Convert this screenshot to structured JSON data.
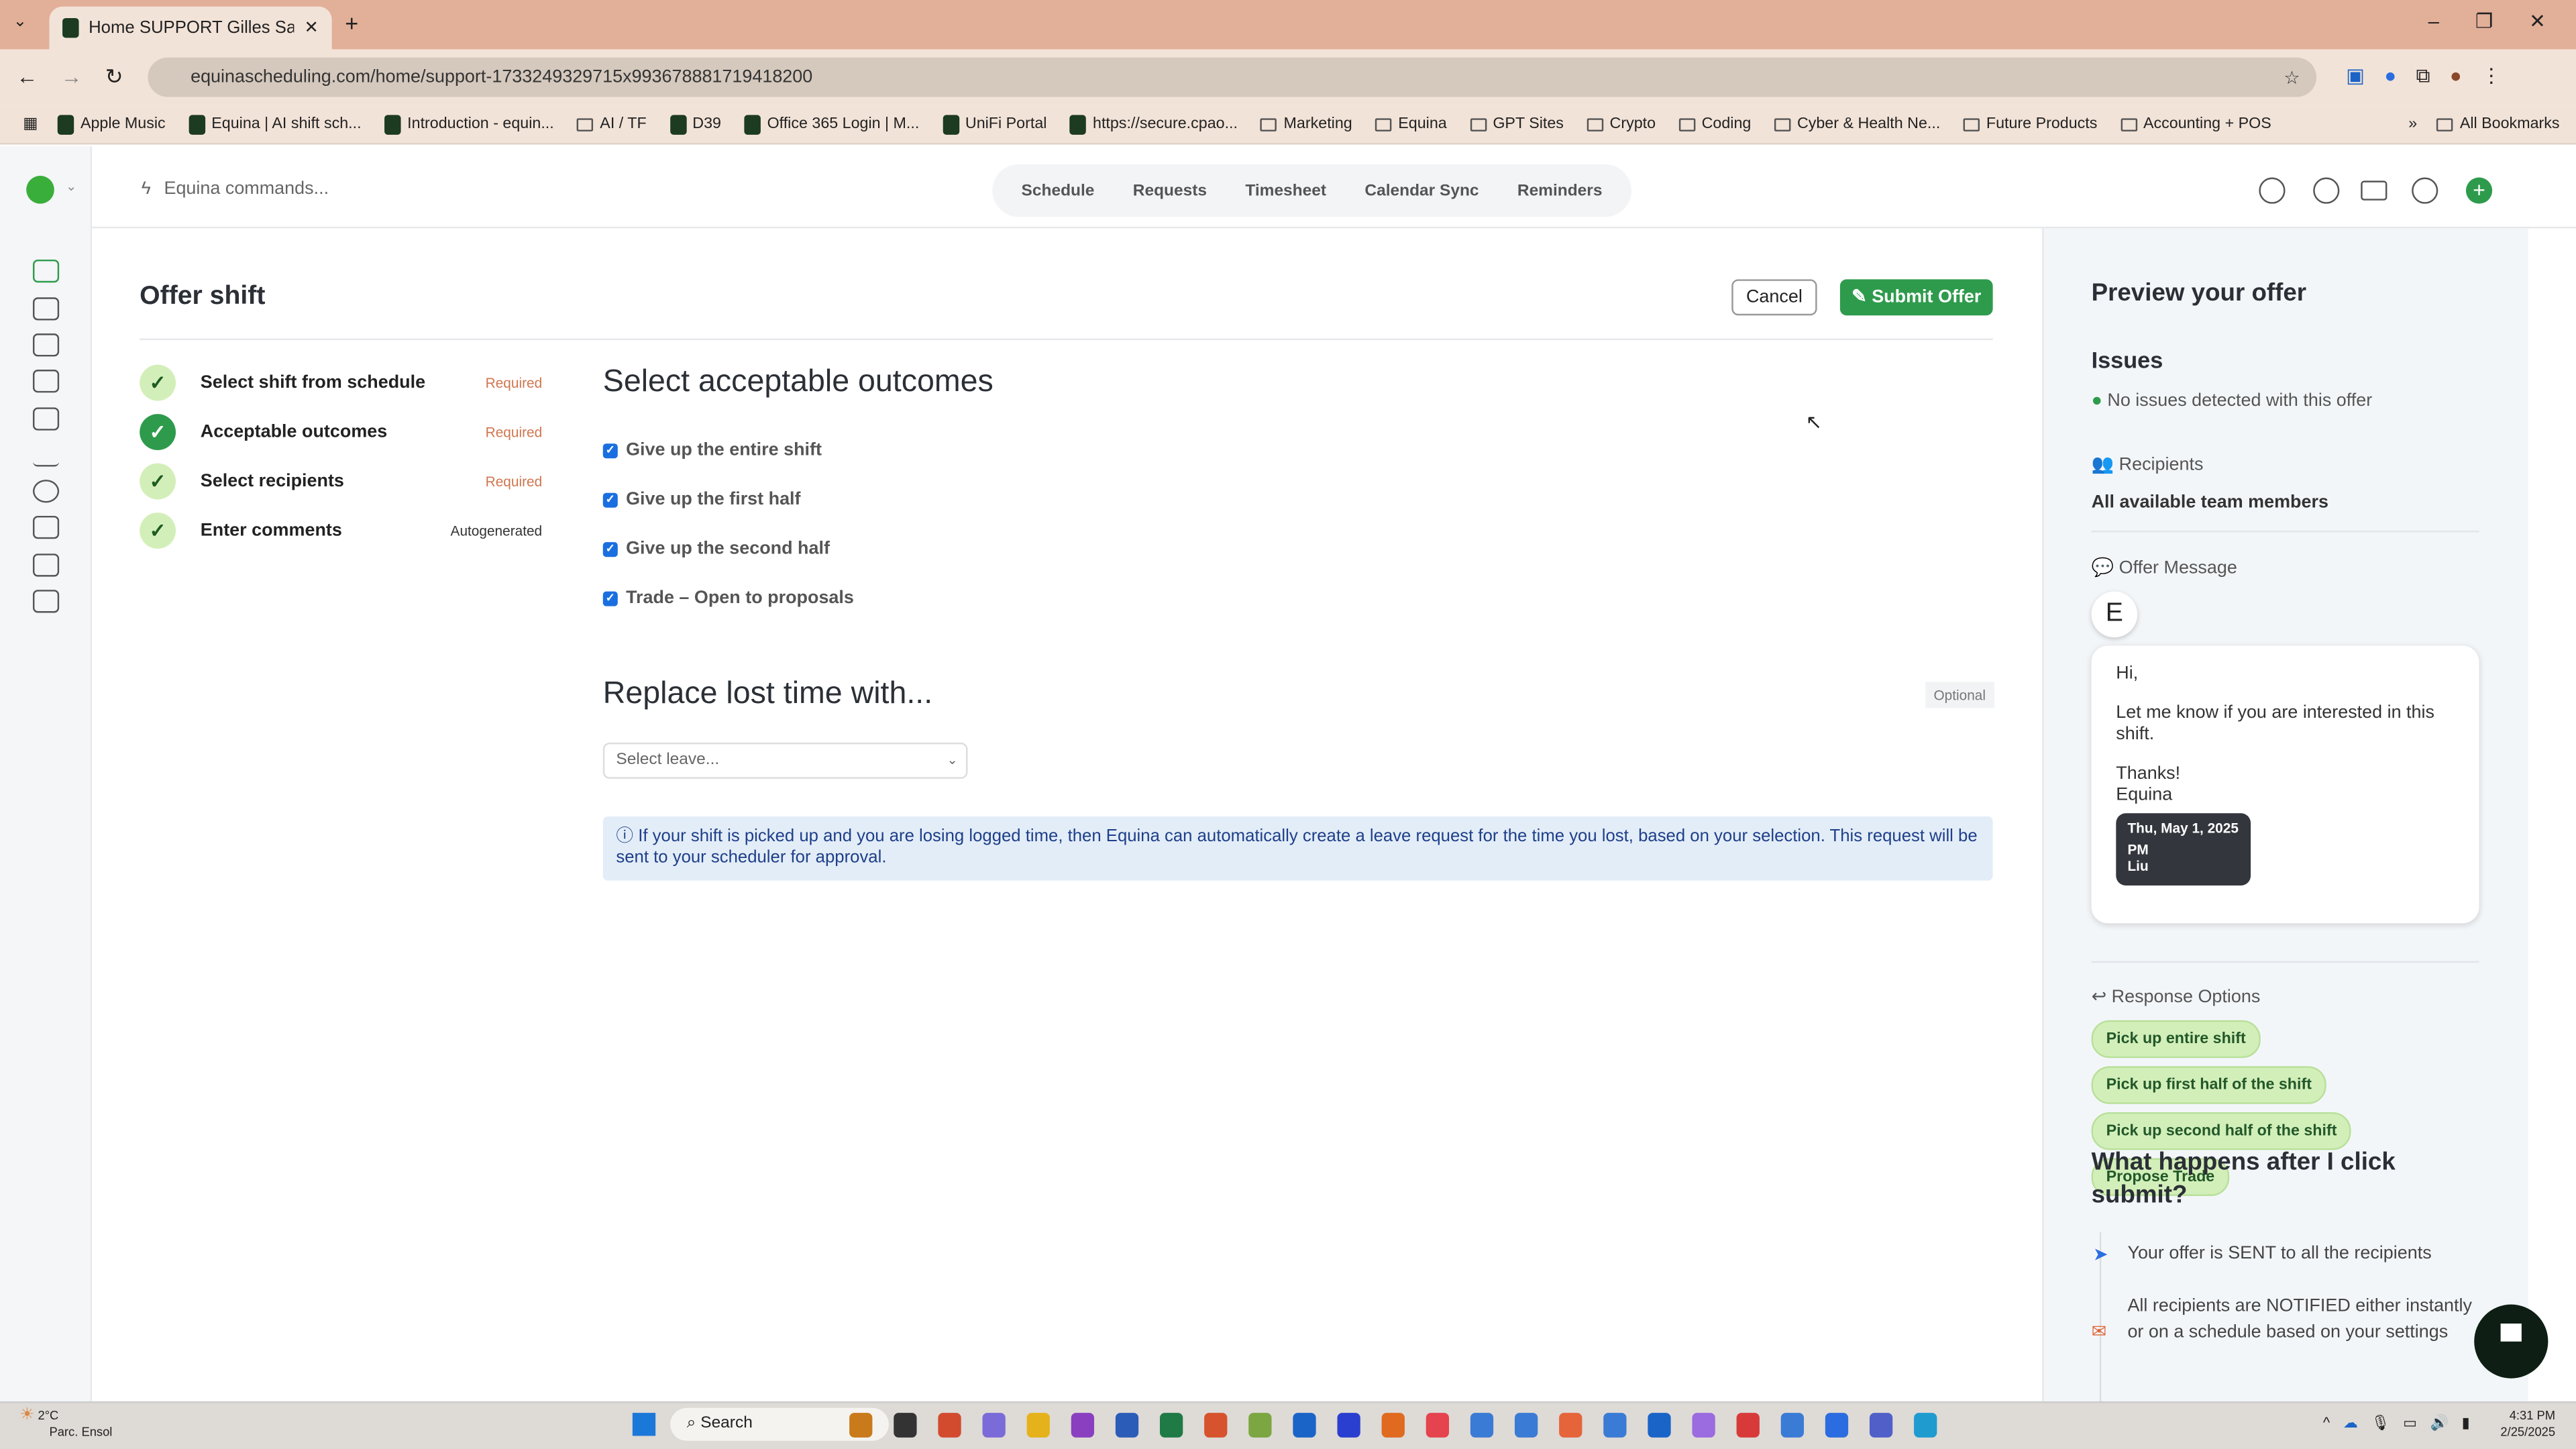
{
  "browser": {
    "tab_title": "Home SUPPORT Gilles Sandbo",
    "url": "equinascheduling.com/home/support-1733249329715x993678881719418200",
    "bookmarks": [
      "Apple Music",
      "Equina | AI shift sch...",
      "Introduction - equin...",
      "AI / TF",
      "D39",
      "Office 365 Login | M...",
      "UniFi Portal",
      "https://secure.cpao...",
      "Marketing",
      "Equina",
      "GPT Sites",
      "Crypto",
      "Coding",
      "Cyber & Health Ne...",
      "Future Products",
      "Accounting + POS"
    ],
    "all_bookmarks": "All Bookmarks"
  },
  "topbar": {
    "command_placeholder": "Equina commands...",
    "nav": [
      "Schedule",
      "Requests",
      "Timesheet",
      "Calendar Sync",
      "Reminders"
    ]
  },
  "page": {
    "title": "Offer shift",
    "cancel": "Cancel",
    "submit": "Submit Offer",
    "steps": [
      {
        "label": "Select shift from schedule",
        "tag": "Required"
      },
      {
        "label": "Acceptable outcomes",
        "tag": "Required"
      },
      {
        "label": "Select recipients",
        "tag": "Required"
      },
      {
        "label": "Enter comments",
        "tag": "Autogenerated"
      }
    ],
    "outcomes_title": "Select acceptable outcomes",
    "outcomes": [
      "Give up the entire shift",
      "Give up the first half",
      "Give up the second half",
      "Trade – Open to proposals"
    ],
    "replace_title": "Replace lost time with...",
    "optional": "Optional",
    "select_placeholder": "Select leave...",
    "info": "If your shift is picked up and you are losing logged time, then Equina can automatically create a leave request for the time you lost, based on your selection. This request will be sent to your scheduler for approval."
  },
  "preview": {
    "title": "Preview your offer",
    "issues_title": "Issues",
    "issues_text": "No issues detected with this offer",
    "recipients_label": "Recipients",
    "recipients_value": "All available team members",
    "message_label": "Offer Message",
    "avatar": "E",
    "message": {
      "greeting": "Hi,",
      "body": "Let me know if you are interested in this shift.",
      "thanks": "Thanks!",
      "sign": "Equina"
    },
    "shift_card": {
      "date": "Thu, May 1, 2025",
      "time": "PM",
      "name": "Liu"
    },
    "response_label": "Response Options",
    "responses": [
      "Pick up entire shift",
      "Pick up first half of the shift",
      "Pick up second half of the shift",
      "Propose Trade"
    ],
    "after_title": "What happens after I click submit?",
    "after_steps": [
      "Your offer is SENT to all the recipients",
      "All recipients are NOTIFIED either instantly or on a schedule based on your settings"
    ]
  },
  "taskbar": {
    "weather_temp": "2°C",
    "weather_desc": "Parc. Ensol",
    "search": "Search",
    "time": "4:31 PM",
    "date": "2/25/2025",
    "icon_colors": [
      "#c97a1a",
      "#333",
      "#d34b2f",
      "#7b6bd8",
      "#e6b21b",
      "#8a3fc0",
      "#2b5cb8",
      "#1f7a45",
      "#d6532d",
      "#7ca641",
      "#1a64c8",
      "#2a3fd0",
      "#e06a1f",
      "#e5434d",
      "#3a7bd5",
      "#3a7bd5",
      "#e5643a",
      "#3a7bd5",
      "#1a64c8",
      "#9b6be0",
      "#d83a3a",
      "#3a7bd5",
      "#2b6de0",
      "#5060c8",
      "#1f9bd0"
    ]
  },
  "colors": {
    "accent": "#2e9b4c",
    "required": "#d0764f",
    "chip": "#d3efb9",
    "checkbox": "#1a6fe0"
  }
}
